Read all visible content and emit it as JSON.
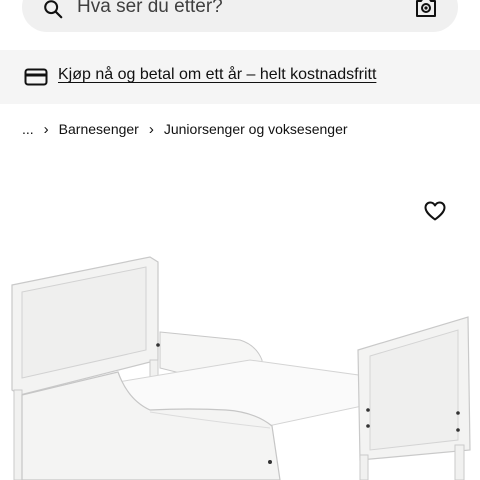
{
  "search": {
    "placeholder": "Hva ser du etter?"
  },
  "promo": {
    "text": "Kjøp nå og betal om ett år – helt kostnadsfritt"
  },
  "breadcrumb": {
    "ellipsis": "...",
    "items": [
      "Barnesenger",
      "Juniorsenger og voksesenger"
    ]
  },
  "icons": {
    "search": "search-icon",
    "camera": "camera-search-icon",
    "card": "credit-card-icon",
    "favorite": "heart-outline-icon"
  },
  "colors": {
    "search_bg": "#f0f0f0",
    "promo_bg": "#f5f5f5",
    "text": "#111111"
  }
}
